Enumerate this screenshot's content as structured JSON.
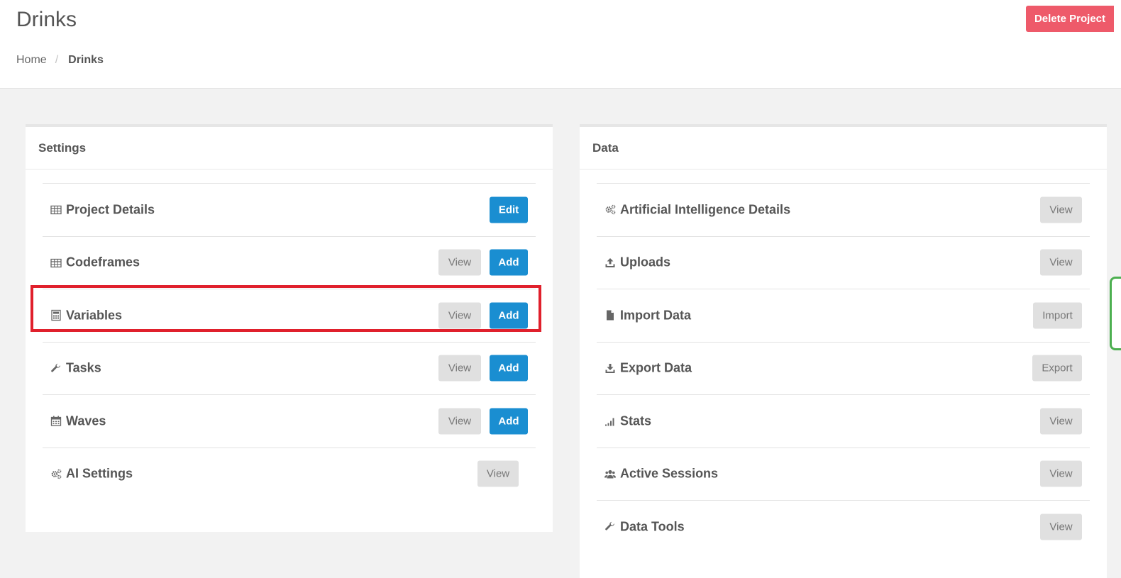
{
  "header": {
    "title": "Drinks",
    "delete_label": "Delete Project",
    "breadcrumb": {
      "home": "Home",
      "separator": "/",
      "current": "Drinks"
    }
  },
  "settings": {
    "title": "Settings",
    "rows": [
      {
        "label": "Project Details",
        "icon": "table-icon",
        "edit": "Edit"
      },
      {
        "label": "Codeframes",
        "icon": "table-icon",
        "view": "View",
        "add": "Add"
      },
      {
        "label": "Variables",
        "icon": "calculator-icon",
        "view": "View",
        "add": "Add"
      },
      {
        "label": "Tasks",
        "icon": "wrench-icon",
        "view": "View",
        "add": "Add"
      },
      {
        "label": "Waves",
        "icon": "calendar-icon",
        "view": "View",
        "add": "Add"
      },
      {
        "label": "AI Settings",
        "icon": "cogs-icon",
        "view": "View"
      }
    ]
  },
  "data_panel": {
    "title": "Data",
    "rows": [
      {
        "label": "Artificial Intelligence Details",
        "icon": "cogs-icon",
        "action": "View"
      },
      {
        "label": "Uploads",
        "icon": "upload-icon",
        "action": "View"
      },
      {
        "label": "Import Data",
        "icon": "file-icon",
        "action": "Import"
      },
      {
        "label": "Export Data",
        "icon": "download-icon",
        "action": "Export"
      },
      {
        "label": "Stats",
        "icon": "signal-icon",
        "action": "View"
      },
      {
        "label": "Active Sessions",
        "icon": "users-icon",
        "action": "View"
      },
      {
        "label": "Data Tools",
        "icon": "wrench-icon",
        "action": "View"
      }
    ]
  },
  "colors": {
    "primary": "#1a8ed1",
    "danger": "#ee5a6a",
    "highlight": "#e0202c",
    "side_tab": "#4caf50"
  }
}
